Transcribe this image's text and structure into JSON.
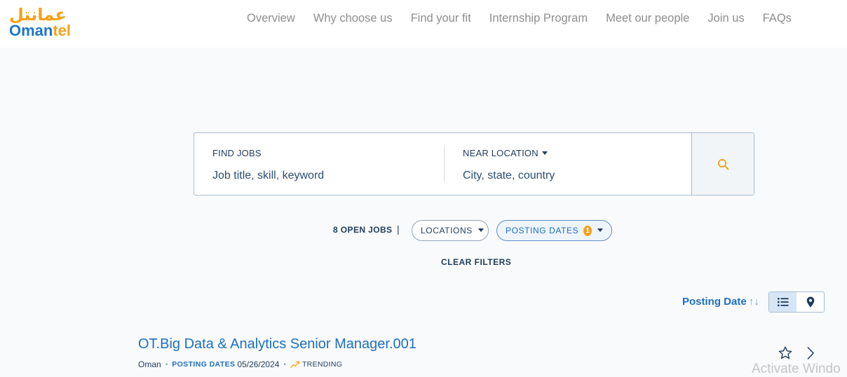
{
  "header": {
    "logo_arabic": "عمانتل",
    "logo_latin_main": "Oman",
    "logo_latin_accent": "tel",
    "nav": [
      "Overview",
      "Why choose us",
      "Find your fit",
      "Internship Program",
      "Meet our people",
      "Join us",
      "FAQs"
    ]
  },
  "search": {
    "jobs_label": "FIND JOBS",
    "jobs_placeholder": "Job title, skill, keyword",
    "location_label": "NEAR LOCATION",
    "location_placeholder": "City, state, country",
    "button_icon": "search-icon"
  },
  "filters": {
    "open_jobs": "8 OPEN JOBS",
    "separator": "|",
    "locations_label": "LOCATIONS",
    "posting_dates_label": "POSTING DATES",
    "posting_dates_count": "1",
    "clear_label": "CLEAR FILTERS"
  },
  "sort": {
    "label": "Posting Date",
    "arrows": "↑↓",
    "views": [
      "list-icon",
      "map-pin-icon"
    ],
    "active_view": "list"
  },
  "jobs": [
    {
      "title": "OT.Big Data & Analytics Senior Manager.001",
      "location": "Oman",
      "posting_label": "POSTING DATES",
      "posting_date": "05/26/2024",
      "trending_label": "TRENDING"
    }
  ],
  "watermark": "Activate Windo",
  "colors": {
    "brand_blue": "#1c76c9",
    "brand_orange": "#f4a21a",
    "link_blue": "#1c6fc2",
    "navy_text": "#1f3b5c",
    "nav_gray": "#8d8d8d"
  }
}
